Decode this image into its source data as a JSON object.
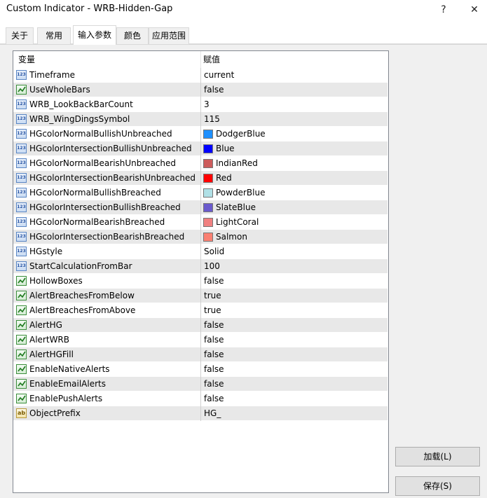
{
  "window": {
    "title": "Custom Indicator - WRB-Hidden-Gap",
    "help_glyph": "?",
    "close_glyph": "✕"
  },
  "tabs": [
    {
      "label": "关于"
    },
    {
      "label": "常用"
    },
    {
      "label": "输入参数"
    },
    {
      "label": "颜色"
    },
    {
      "label": "应用范围"
    }
  ],
  "active_tab": 2,
  "table": {
    "headers": {
      "variable": "变量",
      "value": "赋值"
    },
    "rows": [
      {
        "name": "Timeframe",
        "type": "int",
        "value": "current"
      },
      {
        "name": "UseWholeBars",
        "type": "bool",
        "value": "false"
      },
      {
        "name": "WRB_LookBackBarCount",
        "type": "int",
        "value": "3"
      },
      {
        "name": "WRB_WingDingsSymbol",
        "type": "int",
        "value": "115"
      },
      {
        "name": "HGcolorNormalBullishUnbreached",
        "type": "color",
        "value": "DodgerBlue",
        "color": "#1E90FF"
      },
      {
        "name": "HGcolorIntersectionBullishUnbreached",
        "type": "color",
        "value": "Blue",
        "color": "#0000FF"
      },
      {
        "name": "HGcolorNormalBearishUnbreached",
        "type": "color",
        "value": "IndianRed",
        "color": "#CD5C5C"
      },
      {
        "name": "HGcolorIntersectionBearishUnbreached",
        "type": "color",
        "value": "Red",
        "color": "#FF0000"
      },
      {
        "name": "HGcolorNormalBullishBreached",
        "type": "color",
        "value": "PowderBlue",
        "color": "#B0E0E6"
      },
      {
        "name": "HGcolorIntersectionBullishBreached",
        "type": "color",
        "value": "SlateBlue",
        "color": "#6A5ACD"
      },
      {
        "name": "HGcolorNormalBearishBreached",
        "type": "color",
        "value": "LightCoral",
        "color": "#F08080"
      },
      {
        "name": "HGcolorIntersectionBearishBreached",
        "type": "color",
        "value": "Salmon",
        "color": "#FA8072"
      },
      {
        "name": "HGstyle",
        "type": "int",
        "value": "Solid"
      },
      {
        "name": "StartCalculationFromBar",
        "type": "int",
        "value": "100"
      },
      {
        "name": "HollowBoxes",
        "type": "bool",
        "value": "false"
      },
      {
        "name": "AlertBreachesFromBelow",
        "type": "bool",
        "value": "true"
      },
      {
        "name": "AlertBreachesFromAbove",
        "type": "bool",
        "value": "true"
      },
      {
        "name": "AlertHG",
        "type": "bool",
        "value": "false"
      },
      {
        "name": "AlertWRB",
        "type": "bool",
        "value": "false"
      },
      {
        "name": "AlertHGFill",
        "type": "bool",
        "value": "false"
      },
      {
        "name": "EnableNativeAlerts",
        "type": "bool",
        "value": "false"
      },
      {
        "name": "EnableEmailAlerts",
        "type": "bool",
        "value": "false"
      },
      {
        "name": "EnablePushAlerts",
        "type": "bool",
        "value": "false"
      },
      {
        "name": "ObjectPrefix",
        "type": "string",
        "value": "HG_"
      }
    ]
  },
  "icon_labels": {
    "int": "123",
    "string": "ab"
  },
  "buttons": {
    "load": "加载(L)",
    "save": "保存(S)"
  }
}
